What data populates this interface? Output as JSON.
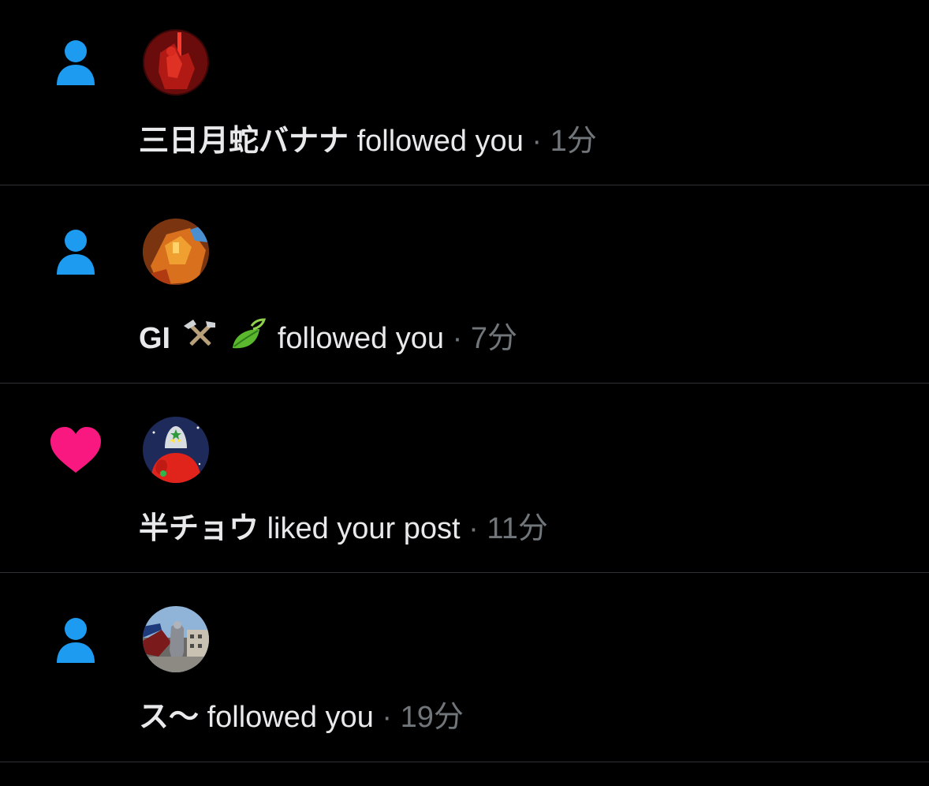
{
  "colors": {
    "follow_icon": "#1d9bf0",
    "like_icon": "#f91880",
    "text_primary": "#e7e9ea",
    "text_secondary": "#71767b",
    "divider": "#2f3336",
    "background": "#000000"
  },
  "notifications": [
    {
      "type_icon": "person-icon",
      "name": "三日月蛇バナナ",
      "action": "followed you",
      "separator": "·",
      "time": "1分"
    },
    {
      "type_icon": "person-icon",
      "name": "GI",
      "name_emojis": [
        "hammer-pick-emoji",
        "leaves-emoji"
      ],
      "action": "followed you",
      "separator": "·",
      "time": "7分"
    },
    {
      "type_icon": "heart-icon",
      "name": "半チョウ",
      "action": "liked your post",
      "separator": "·",
      "time": "11分"
    },
    {
      "type_icon": "person-icon",
      "name": "ス〜",
      "action": "followed you",
      "separator": "·",
      "time": "19分"
    }
  ]
}
